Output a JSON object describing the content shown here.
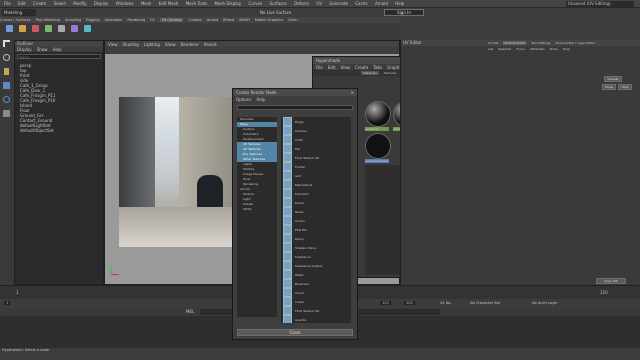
{
  "app": {
    "window_title": "Autodesk Maya",
    "menu": [
      "File",
      "Edit",
      "Create",
      "Select",
      "Modify",
      "Display",
      "Windows",
      "Mesh",
      "Edit Mesh",
      "Mesh Tools",
      "Mesh Display",
      "Curves",
      "Surfaces",
      "Deform",
      "UV",
      "Generate",
      "Cache",
      "Arnold",
      "Help"
    ],
    "workspace": "Unsaved (UV Editing)",
    "mode": "Modeling",
    "live_surface": "No Live Surface",
    "sign_in": "Sign In",
    "shelf_tabs": [
      "Curves / Surfaces",
      "Poly Modeling",
      "Sculpting",
      "Rigging",
      "Animation",
      "Rendering",
      "FX",
      "FX Caching",
      "Custom",
      "Arnold",
      "Bifrost",
      "MASH",
      "Motion Graphics",
      "XGen"
    ]
  },
  "outliner": {
    "title": "Outliner",
    "menu": [
      "Display",
      "Show",
      "Help"
    ],
    "search_placeholder": "Search...",
    "items": [
      "persp",
      "top",
      "front",
      "side",
      "Cafe_1_Group",
      "Cafe_Door_1",
      "Cafe_Frnsgrn_P11",
      "Cafe_Frnsgrn_P10",
      "Island",
      "Floor",
      "Ground_Grs",
      "Contact_Ground",
      "defaultLightSet",
      "defaultObjectSet"
    ]
  },
  "viewport": {
    "menu": [
      "View",
      "Shading",
      "Lighting",
      "Show",
      "Renderer",
      "Panels"
    ],
    "label": "persp"
  },
  "create_render_node": {
    "title": "Create Render Node",
    "menu": [
      "Options",
      "Help"
    ],
    "search_value": "",
    "categories": [
      "Favorites",
      "Maya",
      "Surface",
      "Volumetric",
      "Displacement",
      "2D Textures",
      "3D Textures",
      "Env Textures",
      "Other Textures",
      "Lights",
      "Utilities",
      "Image Planes",
      "Glow",
      "Rendering",
      "Arnold",
      "Texture",
      "Light",
      "Shader",
      "Utility"
    ],
    "nodes": [
      "Bulge",
      "Checker",
      "Cloth",
      "File",
      "Fluid Texture 2D",
      "Fractal",
      "Grid",
      "Mandelbrot",
      "Mountain",
      "Movie",
      "Noise",
      "Ocean",
      "PSD File",
      "Ramp",
      "Shaders Menu",
      "Substance",
      "Substance Output",
      "Water",
      "Brownian",
      "Cloud",
      "Crater",
      "Fluid Texture 3D",
      "Granite",
      "Leather",
      "Mandelbrot 3D",
      "Marble"
    ],
    "close_label": "Close"
  },
  "hypershade": {
    "title": "Hypershade",
    "menu": [
      "File",
      "Edit",
      "View",
      "Create",
      "Tabs",
      "Graph",
      "Window",
      "Options",
      "Help"
    ],
    "browser_tabs": [
      "Materials",
      "Textures",
      "Utilities",
      "Rendering",
      "Lights",
      "Cameras",
      "Shading Groups"
    ],
    "materials": [
      "lambert1",
      "particleCloud1",
      "standardSurface1",
      "shaderGlow1",
      "surfaceShader1"
    ],
    "material_viewer": "Material Viewer",
    "viewer_type": "Hardware",
    "viewer_shape": "Shader Ball",
    "viewer_env": "Fancy Color",
    "graph_node": "OHBZUS_T",
    "property_editor": {
      "title": "Property Editor",
      "node_type": "surfaceShader",
      "node_name": "surfaceShader1",
      "presets": "Presets",
      "view": "View: Lookdev",
      "template": "Template: surfaceShader",
      "section": "Surface Shader Attributes",
      "attributes": [
        "Out Color",
        "Out Transparency",
        "Out Glow Color",
        "Out Matte Opacity"
      ]
    }
  },
  "uv_editor": {
    "title": "UV Editor",
    "tabs": [
      "UV Set",
      "Attribute Editor",
      "Tool Settings",
      "Channel Box / Layer Editor"
    ],
    "menu": [
      "List",
      "Selected",
      "Focus",
      "Attributes",
      "Show",
      "Help"
    ],
    "presets": "Presets",
    "show": "Show",
    "hide": "Hide",
    "copy_tab": "Copy Tab"
  },
  "timeline": {
    "start": "1",
    "end": "120",
    "range_start": "1",
    "range_end": "120",
    "range_end2": "200",
    "fps": "24 fps",
    "character_set": "No Character Set",
    "anim_layer": "No Anim Layer"
  },
  "command_line": {
    "lang": "MEL",
    "help_line": "Hypergraph: Select a node."
  }
}
